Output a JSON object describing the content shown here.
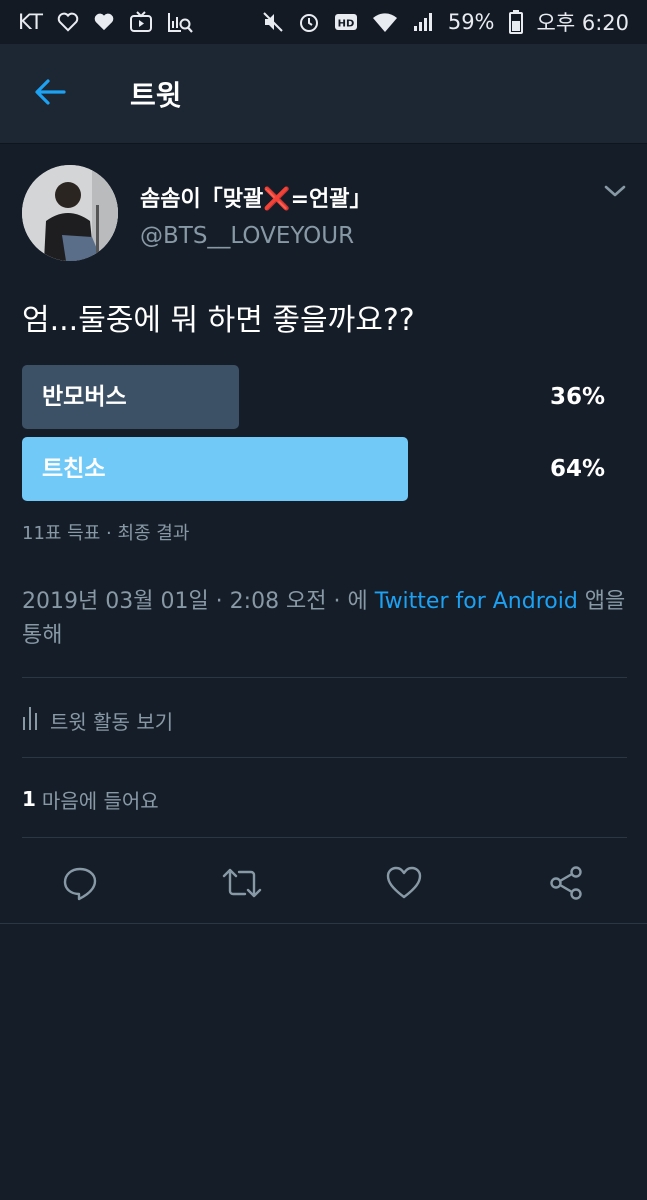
{
  "status_bar": {
    "carrier": "KT",
    "battery": "59%",
    "time": "오후 6:20"
  },
  "header": {
    "title": "트윗"
  },
  "tweet": {
    "author_name": "솜솜이「맞괄❌=언괄」",
    "author_handle": "@BTS__LOVEYOUR",
    "text": "엄...둘중에 뭐 하면 좋을까요??",
    "poll": {
      "options": [
        {
          "label": "반모버스",
          "percent": "36%",
          "value": 36,
          "color": "#3d5166"
        },
        {
          "label": "트친소",
          "percent": "64%",
          "value": 64,
          "color": "#71c9f8"
        }
      ],
      "meta": "11표 득표 · 최종 결과"
    },
    "timestamp_prefix": "2019년 03월 01일 · 2:08 오전 · 에 ",
    "source_link": "Twitter for Android",
    "timestamp_suffix": " 앱을 통해",
    "activity_label": "트윗 활동 보기",
    "likes_count": "1",
    "likes_label": "마음에 들어요"
  },
  "colors": {
    "background": "#151d28",
    "header": "#1d2733",
    "accent": "#1da1f2",
    "secondary_text": "#8899a6"
  },
  "icons": {
    "back": "arrow-left-icon",
    "caret": "chevron-down-icon",
    "activity": "bar-chart-icon",
    "reply": "reply-icon",
    "retweet": "retweet-icon",
    "like": "heart-icon",
    "share": "share-icon"
  }
}
